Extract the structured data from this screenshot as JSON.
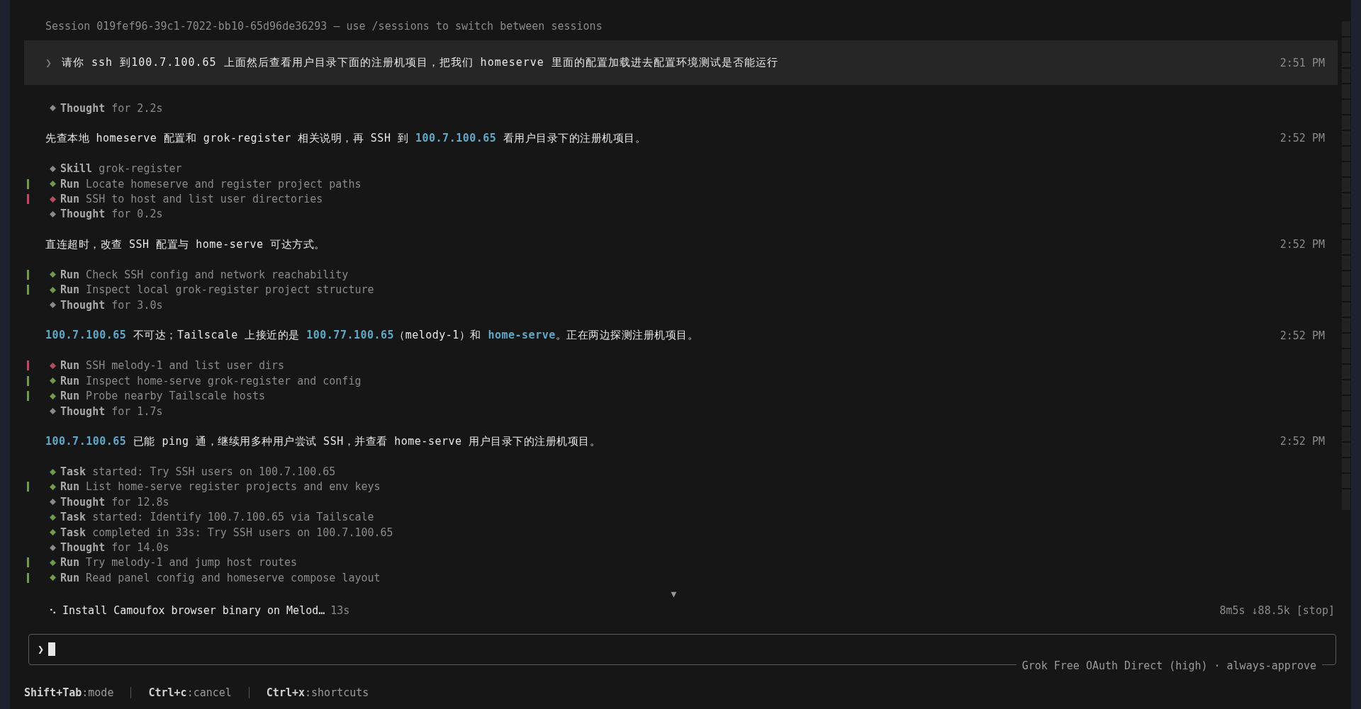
{
  "session": "Session 019fef96-39c1-7022-bb10-65d96de36293 — use /sessions to switch between sessions",
  "user_message": {
    "chevron": "❯",
    "text": "请你 ssh 到100.7.100.65 上面然后查看用户目录下面的注册机项目，把我们 homeserve 里面的配置加载进去配置环境测试是否能运行",
    "time": "2:51 PM"
  },
  "log": [
    {
      "kind": "step",
      "label": "Thought",
      "text": "for 2.2s",
      "color": "#8a8a8a",
      "bar": false
    },
    {
      "kind": "message",
      "time": "2:52 PM",
      "segments": [
        {
          "text": "先查本地 homeserve 配置和 grok-register 相关说明，再 SSH 到 ",
          "highlight": false
        },
        {
          "text": "100.7.100.65",
          "highlight": true
        },
        {
          "text": " 看用户目录下的注册机项目。",
          "highlight": false
        }
      ]
    },
    {
      "kind": "step",
      "label": "Skill",
      "text": "grok-register",
      "color": "#8a8a8a",
      "bar": false
    },
    {
      "kind": "step",
      "label": "Run",
      "text": "Locate homeserve and register project paths",
      "color": "#6f9a4f",
      "bar": true
    },
    {
      "kind": "step",
      "label": "Run",
      "text": "SSH to host and list user directories",
      "color": "#b4505e",
      "bar": true
    },
    {
      "kind": "step",
      "label": "Thought",
      "text": "for 0.2s",
      "color": "#8a8a8a",
      "bar": false
    },
    {
      "kind": "message",
      "time": "2:52 PM",
      "segments": [
        {
          "text": "直连超时，改查 SSH 配置与 home-serve 可达方式。",
          "highlight": false
        }
      ]
    },
    {
      "kind": "step",
      "label": "Run",
      "text": "Check SSH config and network reachability",
      "color": "#6f9a4f",
      "bar": true
    },
    {
      "kind": "step",
      "label": "Run",
      "text": "Inspect local grok-register project structure",
      "color": "#6f9a4f",
      "bar": true
    },
    {
      "kind": "step",
      "label": "Thought",
      "text": "for 3.0s",
      "color": "#8a8a8a",
      "bar": false
    },
    {
      "kind": "message",
      "time": "2:52 PM",
      "segments": [
        {
          "text": "100.7.100.65",
          "highlight": true
        },
        {
          "text": " 不可达；Tailscale 上接近的是 ",
          "highlight": false
        },
        {
          "text": "100.77.100.65",
          "highlight": true
        },
        {
          "text": "（melody-1）和 ",
          "highlight": false
        },
        {
          "text": "home-serve",
          "highlight": true
        },
        {
          "text": "。正在两边探测注册机项目。",
          "highlight": false
        }
      ]
    },
    {
      "kind": "step",
      "label": "Run",
      "text": "SSH melody-1 and list user dirs",
      "color": "#b4505e",
      "bar": true
    },
    {
      "kind": "step",
      "label": "Run",
      "text": "Inspect home-serve grok-register and config",
      "color": "#6f9a4f",
      "bar": true
    },
    {
      "kind": "step",
      "label": "Run",
      "text": "Probe nearby Tailscale hosts",
      "color": "#6f9a4f",
      "bar": true
    },
    {
      "kind": "step",
      "label": "Thought",
      "text": "for 1.7s",
      "color": "#8a8a8a",
      "bar": false
    },
    {
      "kind": "message",
      "time": "2:52 PM",
      "segments": [
        {
          "text": "100.7.100.65",
          "highlight": true
        },
        {
          "text": " 已能 ping 通，继续用多种用户尝试 SSH，并查看 home-serve 用户目录下的注册机项目。",
          "highlight": false
        }
      ]
    },
    {
      "kind": "step",
      "label": "Task",
      "text": "started: Try SSH users on 100.7.100.65",
      "color": "#6f9a4f",
      "bar": false
    },
    {
      "kind": "step",
      "label": "Run",
      "text": "List home-serve register projects and env keys",
      "color": "#6f9a4f",
      "bar": true
    },
    {
      "kind": "step",
      "label": "Thought",
      "text": "for 12.8s",
      "color": "#8a8a8a",
      "bar": false
    },
    {
      "kind": "step",
      "label": "Task",
      "text": "started: Identify 100.7.100.65 via Tailscale",
      "color": "#6f9a4f",
      "bar": false
    },
    {
      "kind": "step",
      "label": "Task",
      "text": "completed in 33s: Try SSH users on 100.7.100.65",
      "color": "#6f9a4f",
      "bar": false
    },
    {
      "kind": "step",
      "label": "Thought",
      "text": "for 14.0s",
      "color": "#8a8a8a",
      "bar": false
    },
    {
      "kind": "step",
      "label": "Run",
      "text": "Try melody-1 and jump host routes",
      "color": "#6f9a4f",
      "bar": true
    },
    {
      "kind": "step",
      "label": "Run",
      "text": "Read panel config and homeserve compose layout",
      "color": "#6f9a4f",
      "bar": true
    }
  ],
  "scroll_marker": "▼",
  "status": {
    "spinner": "⠢",
    "task": "Install Camoufox browser binary on Melod…",
    "elapsed": "13s",
    "stats": "8m5s ↓88.5k [stop]"
  },
  "input": {
    "prompt": "❯",
    "model": "Grok Free OAuth Direct (high)",
    "separator": "·",
    "mode": "always-approve"
  },
  "shortcuts": [
    {
      "key": "Shift+Tab",
      "action": ":mode"
    },
    {
      "key": "Ctrl+c",
      "action": ":cancel"
    },
    {
      "key": "Ctrl+x",
      "action": ":shortcuts"
    }
  ]
}
